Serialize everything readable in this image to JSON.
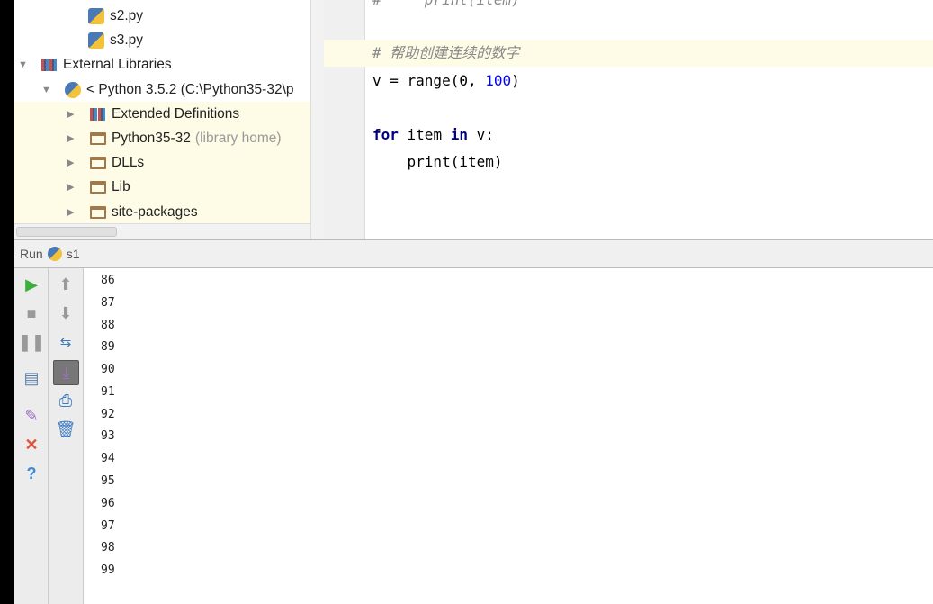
{
  "project_tree": {
    "items": [
      {
        "label": "s2.py",
        "icon": "python-file-icon"
      },
      {
        "label": "s3.py",
        "icon": "python-file-icon"
      },
      {
        "label": "External Libraries",
        "icon": "library-icon",
        "expanded": true
      },
      {
        "label": "< Python 3.5.2 (C:\\Python35-32\\p",
        "icon": "python-icon",
        "expanded": true
      },
      {
        "label": "Extended Definitions",
        "icon": "library-icon"
      },
      {
        "label": "Python35-32",
        "suffix": "(library home)",
        "icon": "folder-icon"
      },
      {
        "label": "DLLs",
        "icon": "folder-icon"
      },
      {
        "label": "Lib",
        "icon": "folder-icon"
      },
      {
        "label": "site-packages",
        "icon": "folder-icon"
      }
    ]
  },
  "editor": {
    "lines": [
      {
        "hash": "#",
        "rest": "     print(item)"
      },
      {
        "comment": "# 帮助创建连续的数字"
      },
      {
        "a": "v = range(0, ",
        "n": "100",
        "b": ")"
      },
      {
        "kw1": "for",
        "mid": " item ",
        "kw2": "in",
        "end": " v:"
      },
      {
        "text": "    print(item)"
      }
    ]
  },
  "run": {
    "label": "Run",
    "config": "s1"
  },
  "toolbar_left": [
    "run-icon",
    "stop-icon",
    "pause-icon",
    "layout-icon",
    "pin-icon",
    "close-icon",
    "help-icon"
  ],
  "toolbar_right": [
    "up-arrow-icon",
    "down-arrow-icon",
    "soft-wrap-icon",
    "scroll-to-end-icon",
    "print-icon",
    "trash-icon"
  ],
  "output": [
    "86",
    "87",
    "88",
    "89",
    "90",
    "91",
    "92",
    "93",
    "94",
    "95",
    "96",
    "97",
    "98",
    "99"
  ]
}
